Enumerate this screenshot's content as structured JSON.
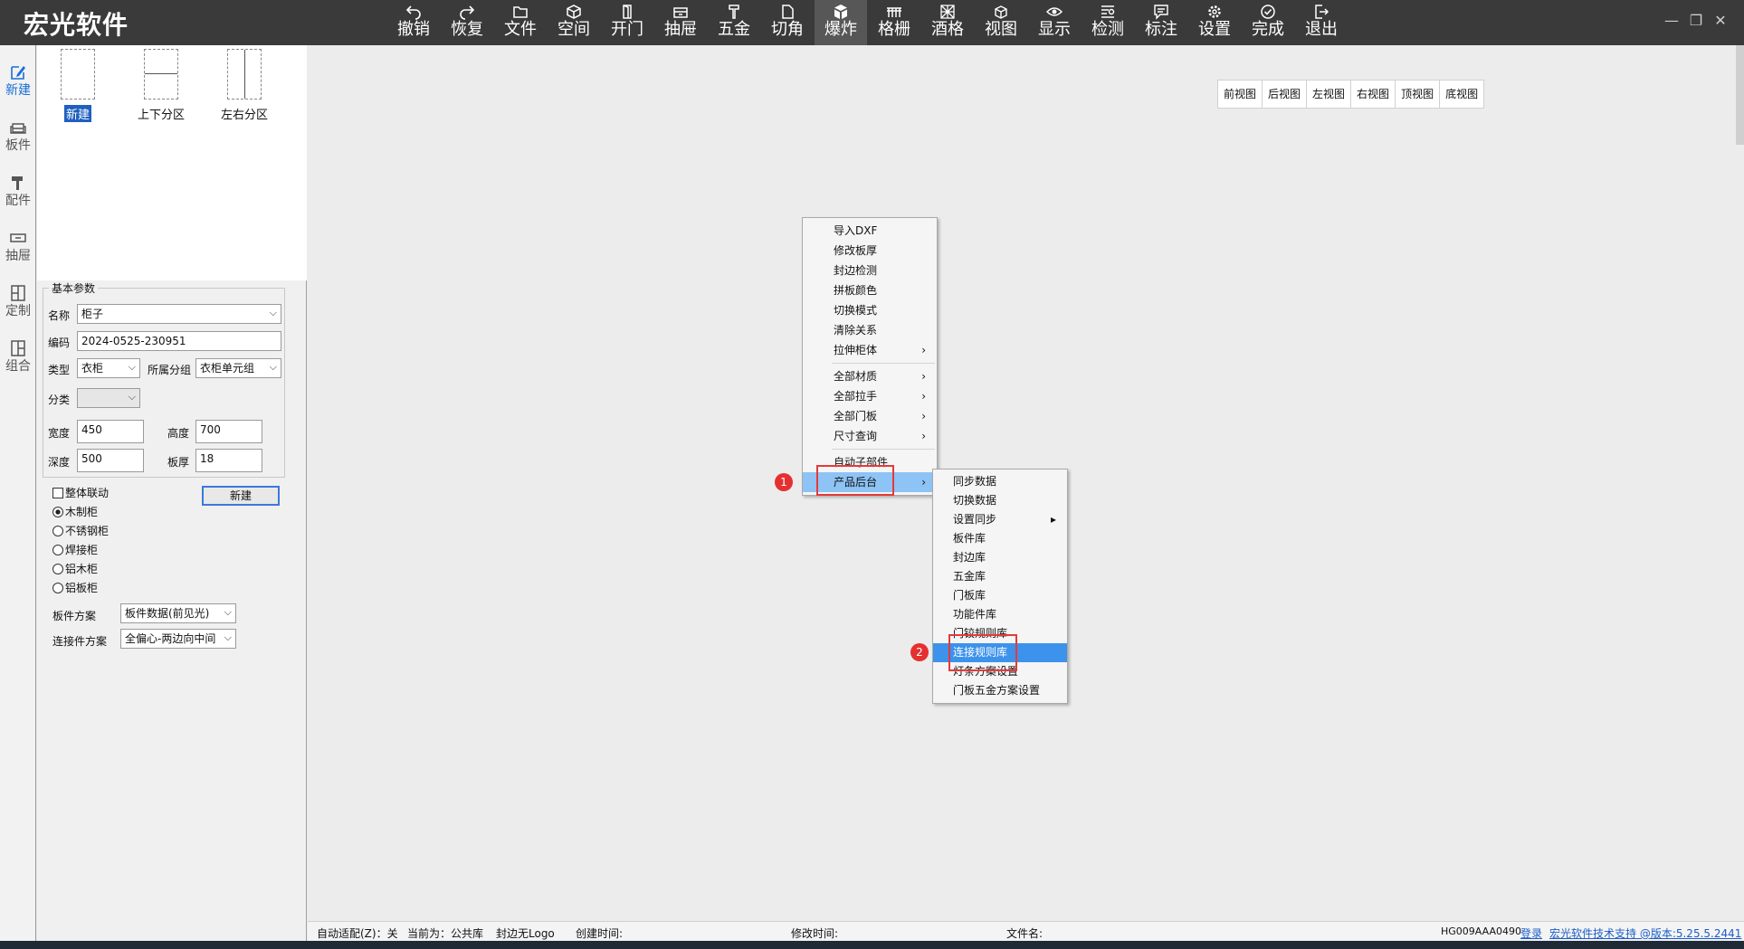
{
  "app": {
    "title": "宏光软件"
  },
  "toolbar": [
    {
      "label": "撤销",
      "icon": "undo-icon"
    },
    {
      "label": "恢复",
      "icon": "redo-icon"
    },
    {
      "label": "文件",
      "icon": "folder-icon"
    },
    {
      "label": "空间",
      "icon": "cube-icon"
    },
    {
      "label": "开门",
      "icon": "door-icon"
    },
    {
      "label": "抽屉",
      "icon": "drawer-icon"
    },
    {
      "label": "五金",
      "icon": "hardware-icon"
    },
    {
      "label": "切角",
      "icon": "corner-cut-icon"
    },
    {
      "label": "爆炸",
      "icon": "explode-icon"
    },
    {
      "label": "格栅",
      "icon": "grille-icon"
    },
    {
      "label": "酒格",
      "icon": "wine-rack-icon"
    },
    {
      "label": "视图",
      "icon": "view-icon"
    },
    {
      "label": "显示",
      "icon": "eye-icon"
    },
    {
      "label": "检测",
      "icon": "inspect-icon"
    },
    {
      "label": "标注",
      "icon": "annotate-icon"
    },
    {
      "label": "设置",
      "icon": "gear-icon"
    },
    {
      "label": "完成",
      "icon": "check-circle-icon"
    },
    {
      "label": "退出",
      "icon": "exit-icon"
    }
  ],
  "window_controls": {
    "minimize": "—",
    "restore": "❐",
    "close": "✕"
  },
  "sidebar": [
    {
      "label": "新建",
      "icon": "edit-icon"
    },
    {
      "label": "板件",
      "icon": "sofa-icon"
    },
    {
      "label": "配件",
      "icon": "hammer-icon"
    },
    {
      "label": "抽屉",
      "icon": "drawer-icon"
    },
    {
      "label": "定制",
      "icon": "layout-icon"
    },
    {
      "label": "组合",
      "icon": "combine-icon"
    }
  ],
  "templates": [
    {
      "label": "新建"
    },
    {
      "label": "上下分区"
    },
    {
      "label": "左右分区"
    }
  ],
  "params": {
    "group_title": "基本参数",
    "name_label": "名称",
    "name_value": "柜子",
    "code_label": "编码",
    "code_value": "2024-0525-230951",
    "type_label": "类型",
    "type_value": "衣柜",
    "group_label": "所属分组",
    "group_value": "衣柜单元组",
    "category_label": "分类",
    "category_value": "",
    "width_label": "宽度",
    "width_value": "450",
    "height_label": "高度",
    "height_value": "700",
    "depth_label": "深度",
    "depth_value": "500",
    "thickness_label": "板厚",
    "thickness_value": "18"
  },
  "options": {
    "linkage_label": "整体联动",
    "new_button": "新建",
    "materials": [
      "木制柜",
      "不锈钢柜",
      "焊接柜",
      "铝木柜",
      "铝板柜"
    ],
    "board_scheme_label": "板件方案",
    "board_scheme_value": "板件数据(前见光)",
    "connector_scheme_label": "连接件方案",
    "connector_scheme_value": "全偏心-两边向中间"
  },
  "views": [
    "前视图",
    "后视图",
    "左视图",
    "右视图",
    "顶视图",
    "底视图"
  ],
  "context_menu": {
    "items_a": [
      "导入DXF",
      "修改板厚",
      "封边检测",
      "拼板颜色",
      "切换模式",
      "清除关系"
    ],
    "stretch": "拉伸柜体",
    "items_b": [
      "全部材质",
      "全部拉手",
      "全部门板",
      "尺寸查询"
    ],
    "auto_sub": "自动子部件",
    "product_backend": "产品后台",
    "arrow": "›"
  },
  "submenu": {
    "items": [
      "同步数据",
      "切换数据",
      "设置同步",
      "板件库",
      "封边库",
      "五金库",
      "门板库",
      "功能件库",
      "门铰规则库",
      "连接规则库",
      "灯条方案设置",
      "门板五金方案设置"
    ],
    "arrow": "▸"
  },
  "badges": [
    "1",
    "2"
  ],
  "status": {
    "auto_fit": "自动适配(Z)：关",
    "current": "当前为：公共库",
    "edge": "封边无Logo",
    "created": "创建时间:",
    "modified": "修改时间:",
    "filename": "文件名:",
    "serial": "HG009AAA0490",
    "login": "登录",
    "support": "宏光软件技术支持 @版本:5.25.5.2441"
  }
}
